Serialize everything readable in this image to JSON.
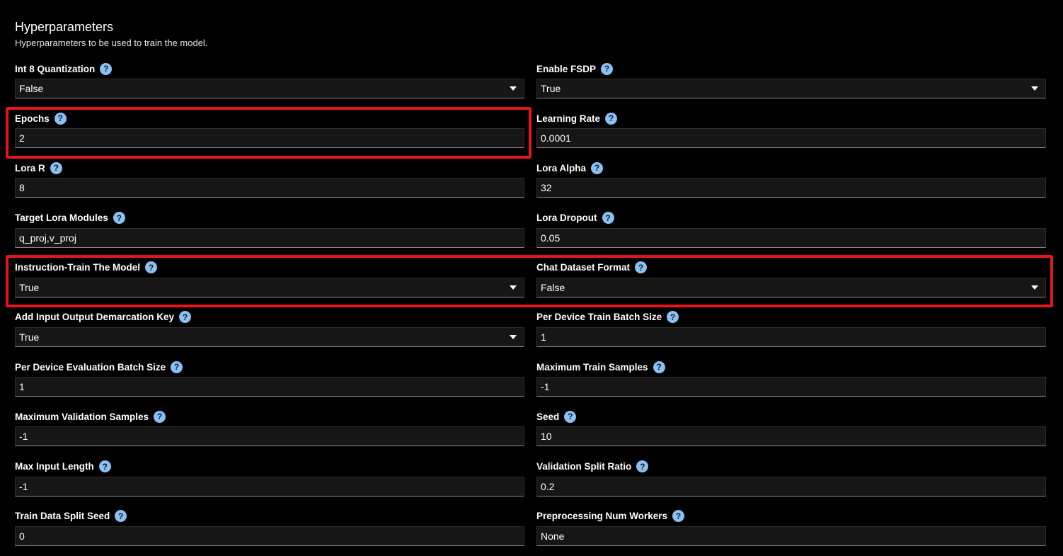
{
  "section": {
    "title": "Hyperparameters",
    "description": "Hyperparameters to be used to train the model."
  },
  "colors": {
    "background": "#000000",
    "highlight": "#e5151e",
    "help_icon": "#8ac1f2"
  },
  "fields": [
    {
      "label": "Int 8 Quantization",
      "value": "False",
      "type": "select"
    },
    {
      "label": "Enable FSDP",
      "value": "True",
      "type": "select"
    },
    {
      "label": "Epochs",
      "value": "2",
      "type": "input"
    },
    {
      "label": "Learning Rate",
      "value": "0.0001",
      "type": "input"
    },
    {
      "label": "Lora R",
      "value": "8",
      "type": "input"
    },
    {
      "label": "Lora Alpha",
      "value": "32",
      "type": "input"
    },
    {
      "label": "Target Lora Modules",
      "value": "q_proj,v_proj",
      "type": "input"
    },
    {
      "label": "Lora Dropout",
      "value": "0.05",
      "type": "input"
    },
    {
      "label": "Instruction-Train The Model",
      "value": "True",
      "type": "select"
    },
    {
      "label": "Chat Dataset Format",
      "value": "False",
      "type": "select"
    },
    {
      "label": "Add Input Output Demarcation Key",
      "value": "True",
      "type": "select"
    },
    {
      "label": "Per Device Train Batch Size",
      "value": "1",
      "type": "input"
    },
    {
      "label": "Per Device Evaluation Batch Size",
      "value": "1",
      "type": "input"
    },
    {
      "label": "Maximum Train Samples",
      "value": "-1",
      "type": "input"
    },
    {
      "label": "Maximum Validation Samples",
      "value": "-1",
      "type": "input"
    },
    {
      "label": "Seed",
      "value": "10",
      "type": "input"
    },
    {
      "label": "Max Input Length",
      "value": "-1",
      "type": "input"
    },
    {
      "label": "Validation Split Ratio",
      "value": "0.2",
      "type": "input"
    },
    {
      "label": "Train Data Split Seed",
      "value": "0",
      "type": "input"
    },
    {
      "label": "Preprocessing Num Workers",
      "value": "None",
      "type": "input"
    }
  ],
  "help_icon_glyph": "?"
}
